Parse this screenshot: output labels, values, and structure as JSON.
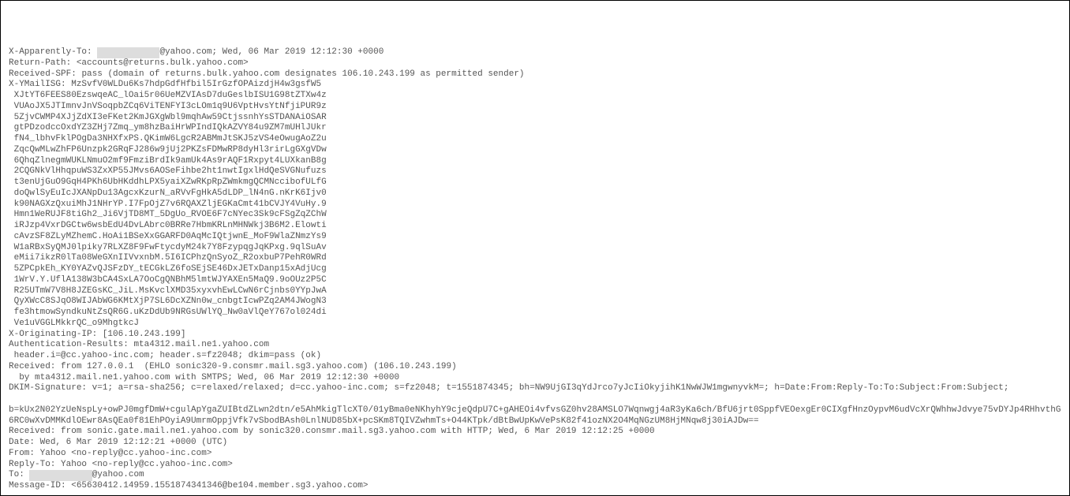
{
  "headers": {
    "x_apparently_to": {
      "label": "X-Apparently-To:",
      "redacted": "xxxxxxxxxxxx",
      "suffix": "@yahoo.com; Wed, 06 Mar 2019 12:12:30 +0000"
    },
    "return_path": {
      "label": "Return-Path:",
      "value": "<accounts@returns.bulk.yahoo.com>"
    },
    "received_spf": {
      "label": "Received-SPF:",
      "value": "pass (domain of returns.bulk.yahoo.com designates 106.10.243.199 as permitted sender)"
    },
    "x_ymailisg": {
      "label": "X-YMailISG:",
      "first_value": "MzSvfV0WLDu6Ks7hdpGdfHfbil5IrGzfOPAizdjH4w3gsfW5",
      "lines": [
        "XJtYT6FEES80EzswqeAC_lOai5r06UeMZVIAsD7duGeslbISU1G98tZTXw4z",
        "VUAoJX5JTImnvJnVSoqpbZCq6ViTENFYI3cLOm1q9U6VptHvsYtNfjiPUR9z",
        "5ZjvCWMP4XJjZdXI3eFKet2KmJGXgWbl9mqhAw59CtjssnhYsSTDANAiOSAR",
        "gtPDzodccOxdYZ3ZHj7Zmq_ym8hzBaiHrWPIndIQkAZVY84u9ZM7mUHlJUkr",
        "fN4_lbhvFklPOgDa3NHXfxPS.QKimW6LgcR2ABMmJtSKJ5zVS4eOwugAoZ2u",
        "ZqcQwMLwZhFP6Unzpk2GRqFJ286w9jUj2PKZsFDMwRP8dyHl3rirLgGXgVDw",
        "6QhqZlnegmWUKLNmuO2mf9FmziBrdIk9amUk4As9rAQF1Rxpyt4LUXkanB8g",
        "2CQGNkVlHhqpuWS3ZxXP55JMvs6AOSeFihbe2ht1nwtIgxlHdQeSVGNufuzs",
        "t3enUjGuO9GqH4PKh6UbHKddhLPX5yaiXZwRKpRpZWmkmgQCMNccibofULfG",
        "doQwlSyEuIcJXANpDu13AgcxKzurN_aRVvFgHkA5dLDP_lN4nG.nKrK6Ijv0",
        "k90NAGXzQxuiMhJ1NHrYP.I7FpOjZ7v6RQAXZljEGKaCmt41bCVJY4VuHy.9",
        "Hmn1WeRUJF8tiGh2_Ji6VjTD8MT_5DgUo_RVOE6F7cNYec3Sk9cFSgZqZChW",
        "iRJzp4VxrDGCtw6wsbEdU4DvLAbrc0BRRe7HbmKRLnMHNWkj3B6M2.Elowti",
        "cAvzSF8ZLyMZhemC.HoAi1BSeXxGGARFD0AqMcIQtjwnE_MoF9WlaZNmzYs9",
        "W1aRBxSyQMJ0lpiky7RLXZ8F9FwFtycdyM24k7Y8FzypqgJqKPxg.9qlSuAv",
        "eMii7ikzR0lTa08WeGXnIIVvxnbM.5I6ICPhzQnSyoZ_R2oxbuP7PehR0WRd",
        "5ZPCpkEh_KY0YAZvQJSFzDY_tECGkLZ6foSEjSE46DxJETxDanp15xAdjUcg",
        "1WrV.Y.UflA138W3bCA4SxLA7OoCgQNBhM5lmtWJYAXEn5MaQ9.9oOUz2P5C",
        "R25UTmW7V8H8JZEGsKC_JiL.MsKvclXMD35xyxvhEwLCwN6rCjnbs0YYpJwA",
        "QyXWcC8SJqO8WIJAbWG6KMtXjP7SL6DcXZNn0w_cnbgtIcwPZq2AM4JWogN3",
        "fe3htmowSyndkuNtZsQR6G.uKzDdUb9NRGsUWlYQ_Nw0aVlQeY767ol024di",
        "Ve1uVGGLMkkrQC_o9MhgtkcJ"
      ]
    },
    "x_originating_ip": {
      "label": "X-Originating-IP:",
      "value": "[106.10.243.199]"
    },
    "authentication_results": {
      "label": "Authentication-Results:",
      "value": "mta4312.mail.ne1.yahoo.com",
      "line2": " header.i=@cc.yahoo-inc.com; header.s=fz2048; dkim=pass (ok)"
    },
    "received1": {
      "label": "Received:",
      "value": "from 127.0.0.1  (EHLO sonic320-9.consmr.mail.sg3.yahoo.com) (106.10.243.199)",
      "line2": "  by mta4312.mail.ne1.yahoo.com with SMTPS; Wed, 06 Mar 2019 12:12:30 +0000"
    },
    "dkim_signature": {
      "label": "DKIM-Signature:",
      "value": "v=1; a=rsa-sha256; c=relaxed/relaxed; d=cc.yahoo-inc.com; s=fz2048; t=1551874345; bh=NW9UjGI3qYdJrco7yJcIiOkyjihK1NwWJW1mgwnyvkM=; h=Date:From:Reply-To:To:Subject:From:Subject;",
      "b_line": " b=kUx2N02YzUeNspLy+owPJ0mgfDmW+cgulApYgaZUIBtdZLwn2dtn/e5AhMkigTlcXT0/01yBma0eNKhyhY9cjeQdpU7C+gAHEOi4vfvsGZ0hv28AMSLO7Wqnwgj4aR3yKa6ch/BfU6jrt0SppfVEOexgEr0CIXgfHnzOypvM6udVcXrQWhhwJdvye75vDYJp4RHhvthG6RC0wXvDMMKdlOEwr8AsQEa0f81EhPOyiA9UmrmOppjVfk7vSbodBAsh0LnlNUD85bX+pcSKm8TQIVZwhmTs+O44KTpk/dBtBwUpKwVePsK82f41ozNX2O4MqNGzUM8HjMNqw8j30iAJDw=="
    },
    "received2": {
      "label": "Received:",
      "value": "from sonic.gate.mail.ne1.yahoo.com by sonic320.consmr.mail.sg3.yahoo.com with HTTP; Wed, 6 Mar 2019 12:12:25 +0000"
    },
    "date": {
      "label": "Date:",
      "value": "Wed, 6 Mar 2019 12:12:21 +0000 (UTC)"
    },
    "from": {
      "label": "From:",
      "value": "Yahoo <no-reply@cc.yahoo-inc.com>"
    },
    "reply_to": {
      "label": "Reply-To:",
      "value": "Yahoo <no-reply@cc.yahoo-inc.com>"
    },
    "to": {
      "label": "To:",
      "redacted": "xxxxxxxxxxxx",
      "suffix": "@yahoo.com"
    },
    "message_id": {
      "label": "Message-ID:",
      "value": "<65630412.14959.1551874341346@be104.member.sg3.yahoo.com>"
    }
  }
}
